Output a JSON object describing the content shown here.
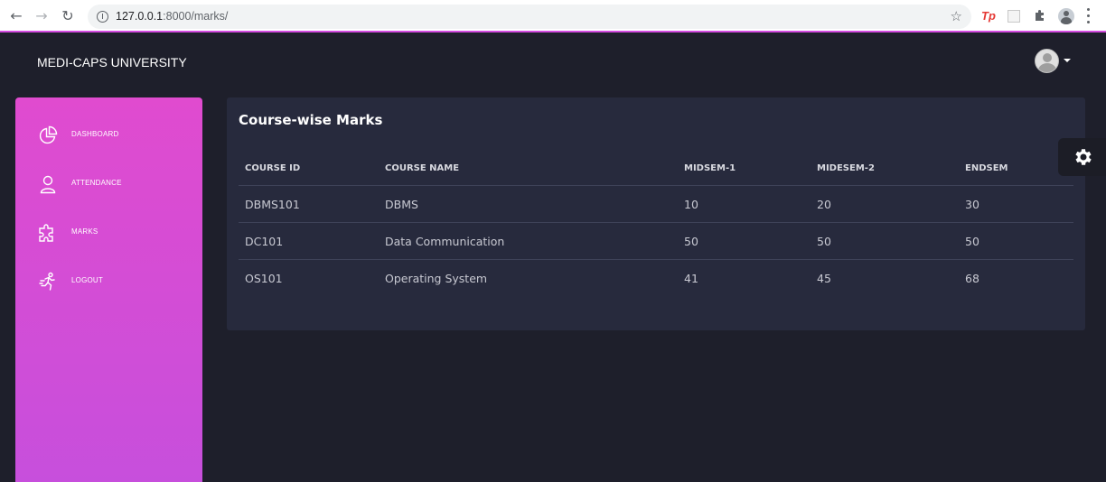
{
  "browser": {
    "url_host": "127.0.0.1",
    "url_path": ":8000/marks/",
    "extension_tp": "Tp"
  },
  "header": {
    "brand": "MEDI-CAPS UNIVERSITY"
  },
  "sidebar": {
    "items": [
      {
        "label": "DASHBOARD",
        "icon": "pie-chart-icon"
      },
      {
        "label": "ATTENDANCE",
        "icon": "user-icon"
      },
      {
        "label": "MARKS",
        "icon": "puzzle-icon"
      },
      {
        "label": "LOGOUT",
        "icon": "running-man-icon"
      }
    ]
  },
  "main": {
    "title": "Course-wise Marks",
    "columns": [
      "COURSE ID",
      "COURSE NAME",
      "MIDSEM-1",
      "MIDESEM-2",
      "ENDSEM"
    ],
    "rows": [
      [
        "DBMS101",
        "DBMS",
        "10",
        "20",
        "30"
      ],
      [
        "DC101",
        "Data Communication",
        "50",
        "50",
        "50"
      ],
      [
        "OS101",
        "Operating System",
        "41",
        "45",
        "68"
      ]
    ]
  },
  "colors": {
    "sidebar_top": "#e04bcf",
    "sidebar_bottom": "#c74fdc",
    "background": "#1e1f2b",
    "card": "#272a3d"
  }
}
